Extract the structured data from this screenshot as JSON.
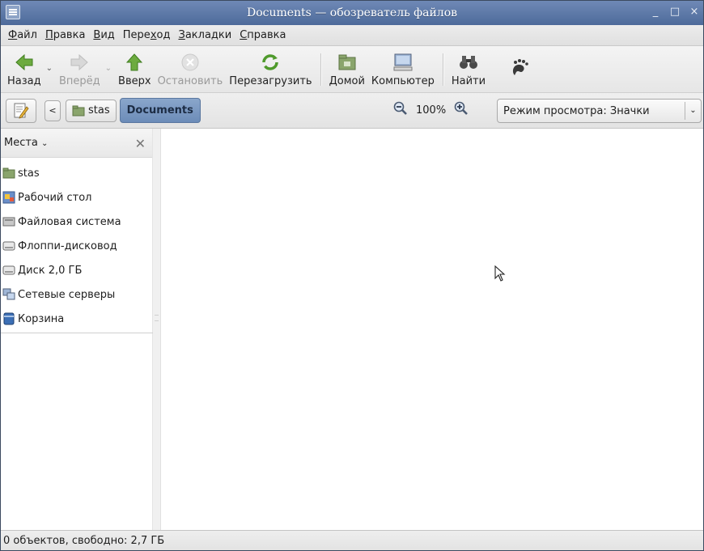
{
  "window": {
    "title": "Documents — обозреватель файлов",
    "controls": [
      "_",
      "□",
      "×"
    ]
  },
  "menubar": [
    {
      "label": "Файл",
      "mnemonic": "Ф",
      "rest": "айл"
    },
    {
      "label": "Правка",
      "mnemonic": "П",
      "rest": "равка"
    },
    {
      "label": "Вид",
      "mnemonic": "В",
      "rest": "ид"
    },
    {
      "label": "Переход",
      "pre": "Пере",
      "mnemonic": "х",
      "rest": "од"
    },
    {
      "label": "Закладки",
      "mnemonic": "З",
      "rest": "акладки"
    },
    {
      "label": "Справка",
      "mnemonic": "С",
      "rest": "правка"
    }
  ],
  "toolbar": {
    "back": "Назад",
    "forward": "Вперёд",
    "up": "Вверх",
    "stop": "Остановить",
    "reload": "Перезагрузить",
    "home": "Домой",
    "computer": "Компьютер",
    "search": "Найти",
    "dropdown_glyph": "⌄"
  },
  "location": {
    "back_glyph": "<",
    "crumbs": [
      "stas"
    ],
    "current": "Documents",
    "zoom_level": "100%",
    "view_mode": "Режим просмотра: Значки",
    "view_arrow": "⌄"
  },
  "sidebar": {
    "header": "Места",
    "header_arrow": "⌄",
    "close_glyph": "✕",
    "items": [
      {
        "label": "stas",
        "icon": "home-folder-icon"
      },
      {
        "label": "Рабочий стол",
        "icon": "desktop-icon"
      },
      {
        "label": "Файловая система",
        "icon": "filesystem-icon"
      },
      {
        "label": "Флоппи-дисковод",
        "icon": "floppy-drive-icon"
      },
      {
        "label": "Диск 2,0 ГБ",
        "icon": "disk-icon"
      },
      {
        "label": "Сетевые серверы",
        "icon": "network-servers-icon"
      },
      {
        "label": "Корзина",
        "icon": "trash-icon"
      }
    ]
  },
  "statusbar": {
    "text": "0 объектов, свободно: 2,7 ГБ"
  },
  "colors": {
    "titlebar": "#5a76a6",
    "active_crumb": "#7b98c1",
    "folder_green": "#7a9a5c",
    "arrow_green": "#4f9a2c"
  }
}
